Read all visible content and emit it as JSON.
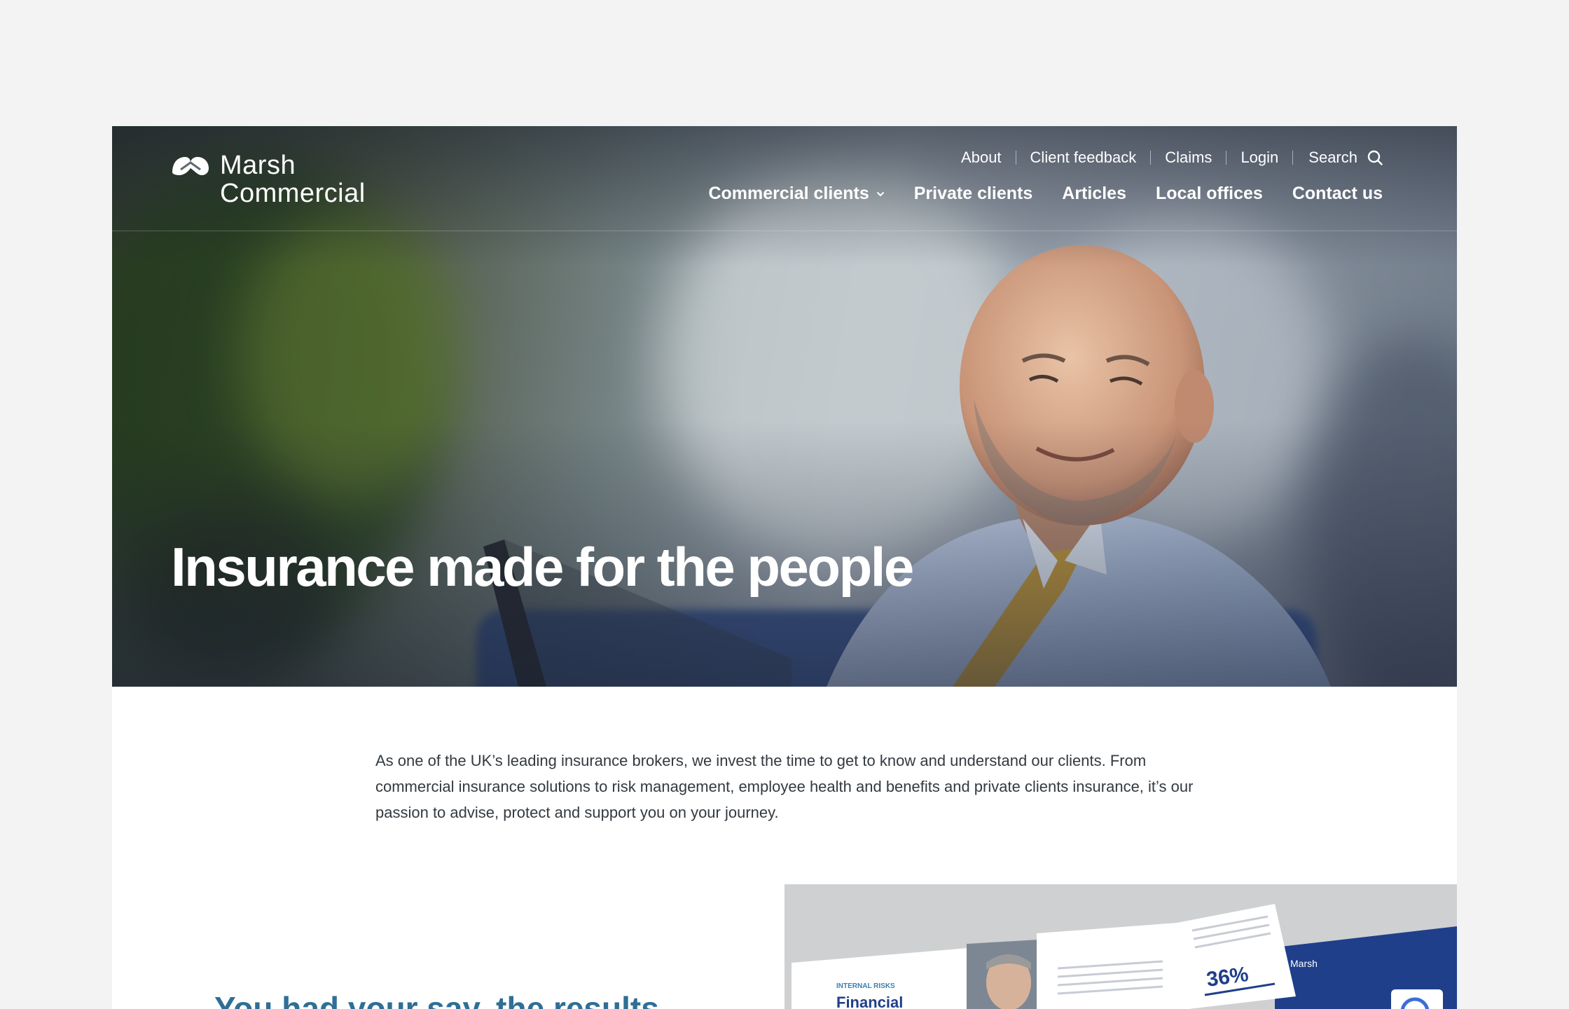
{
  "brand": {
    "line1": "Marsh",
    "line2": "Commercial"
  },
  "utility_nav": {
    "items": [
      "About",
      "Client feedback",
      "Claims",
      "Login"
    ],
    "search_label": "Search"
  },
  "main_nav": {
    "items": [
      "Commercial clients",
      "Private clients",
      "Articles",
      "Local offices",
      "Contact us"
    ]
  },
  "hero": {
    "title": "Insurance made for the people"
  },
  "intro": {
    "text": "As one of the UK’s leading insurance brokers, we invest the time to get to know and understand our clients. From commercial insurance solutions to risk management, employee health and benefits and private clients insurance, it’s our passion to advise, protect and support you on your journey."
  },
  "promo": {
    "heading": "You had your say, the results",
    "report_label": "INTERNAL RISKS",
    "report_title": "Financial",
    "report_stat": "36%",
    "report_brand": "Marsh"
  },
  "colors": {
    "page_bg": "#f2f3f2",
    "heading_blue": "#2f6e96",
    "text": "#333a40",
    "sofa_blue": "#34508a"
  },
  "icons": [
    "logo-mark-icon",
    "search-icon",
    "chevron-down-icon"
  ]
}
